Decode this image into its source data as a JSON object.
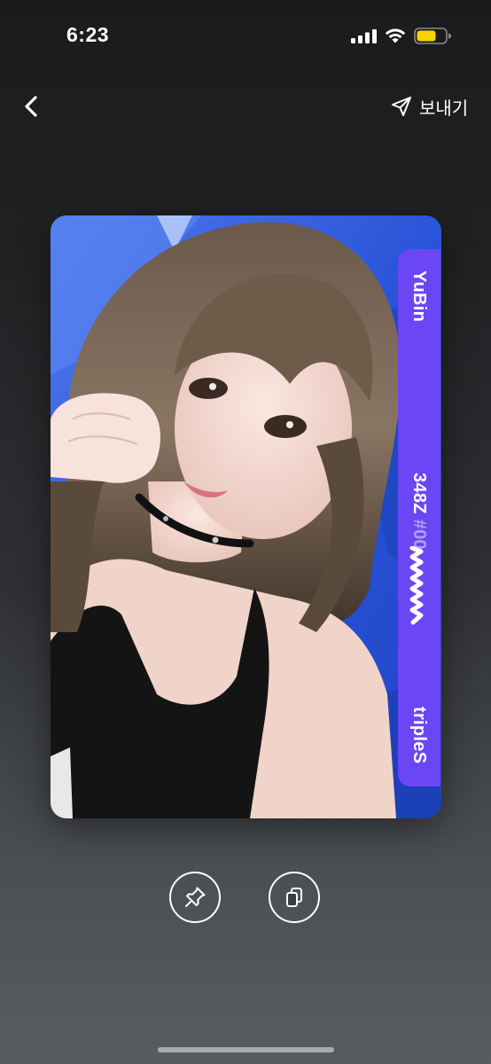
{
  "status_bar": {
    "time": "6:23",
    "battery_color": "#f5d400"
  },
  "nav": {
    "back_icon": "chevron-left-icon",
    "send_icon": "paper-plane-icon",
    "send_label": "보내기"
  },
  "card": {
    "image_description_icon": "photo",
    "band_color": "#6b46f5",
    "member": "YuBin",
    "serial": "348Z",
    "serial_hash": "#00",
    "group": "tripleS"
  },
  "actions": [
    {
      "icon": "pin-icon"
    },
    {
      "icon": "copy-icon"
    }
  ]
}
